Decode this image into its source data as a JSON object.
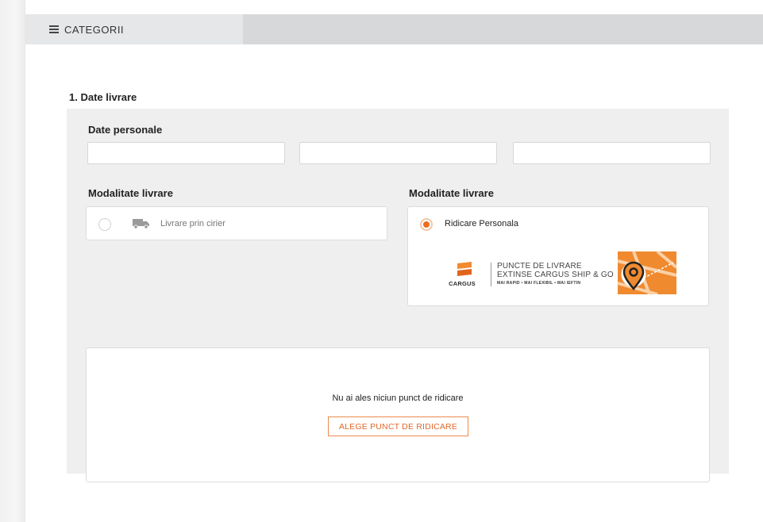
{
  "header": {
    "categories_label": "CATEGORII"
  },
  "section": {
    "title": "1. Date livrare"
  },
  "personal": {
    "heading": "Date personale",
    "fields": [
      {
        "value": "",
        "placeholder": ""
      },
      {
        "value": "",
        "placeholder": ""
      },
      {
        "value": "",
        "placeholder": ""
      }
    ]
  },
  "delivery_left": {
    "heading": "Modalitate livrare",
    "option_label": "Livrare prin cirier",
    "selected": false
  },
  "delivery_right": {
    "heading": "Modalitate livrare",
    "option_label": "Ridicare Personala",
    "selected": true,
    "promo": {
      "brand": "CARGUS",
      "line1": "PUNCTE DE LIVRARE",
      "line2": "EXTINSE CARGUS SHIP & GO",
      "tagline": "MAI RAPID • MAI FLEXIBIL • MAI IEFTIN"
    }
  },
  "pickup": {
    "message": "Nu ai ales niciun punct de ridicare",
    "button_label": "ALEGE PUNCT DE RIDICARE"
  },
  "colors": {
    "accent": "#ec6e21",
    "panel": "#efefef",
    "topbar": "#d6d8da"
  }
}
